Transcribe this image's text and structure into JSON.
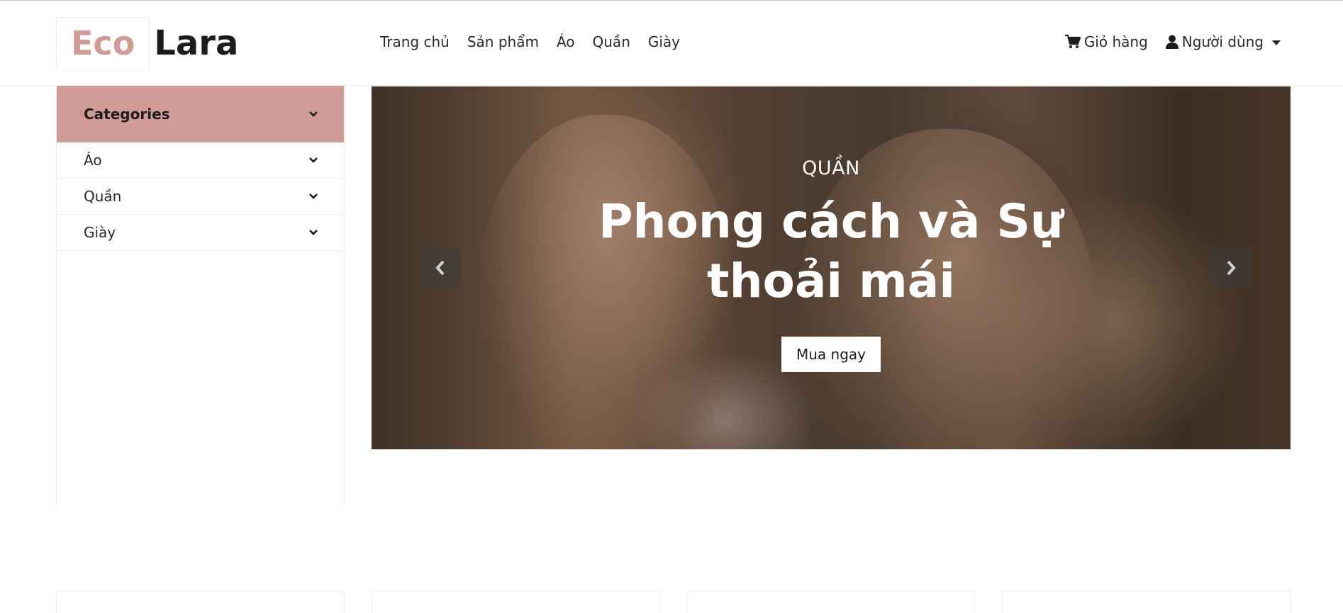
{
  "brand": {
    "part1": "Eco",
    "part2": "Lara",
    "accent_color": "#d19c97"
  },
  "nav": {
    "links": [
      "Trang chủ",
      "Sản phẩm",
      "Áo",
      "Quần",
      "Giày"
    ],
    "cart_label": "Giỏ hàng",
    "cart_icon": "shopping-cart-icon",
    "user_label": "Người dùng",
    "user_icon": "user-icon"
  },
  "sidebar": {
    "title": "Categories",
    "items": [
      {
        "label": "Áo"
      },
      {
        "label": "Quần"
      },
      {
        "label": "Giày"
      }
    ]
  },
  "carousel": {
    "subtitle": "QUẦN",
    "title": "Phong cách và Sự thoải mái",
    "button_label": "Mua ngay",
    "prev_icon": "chevron-left-icon",
    "next_icon": "chevron-right-icon"
  }
}
